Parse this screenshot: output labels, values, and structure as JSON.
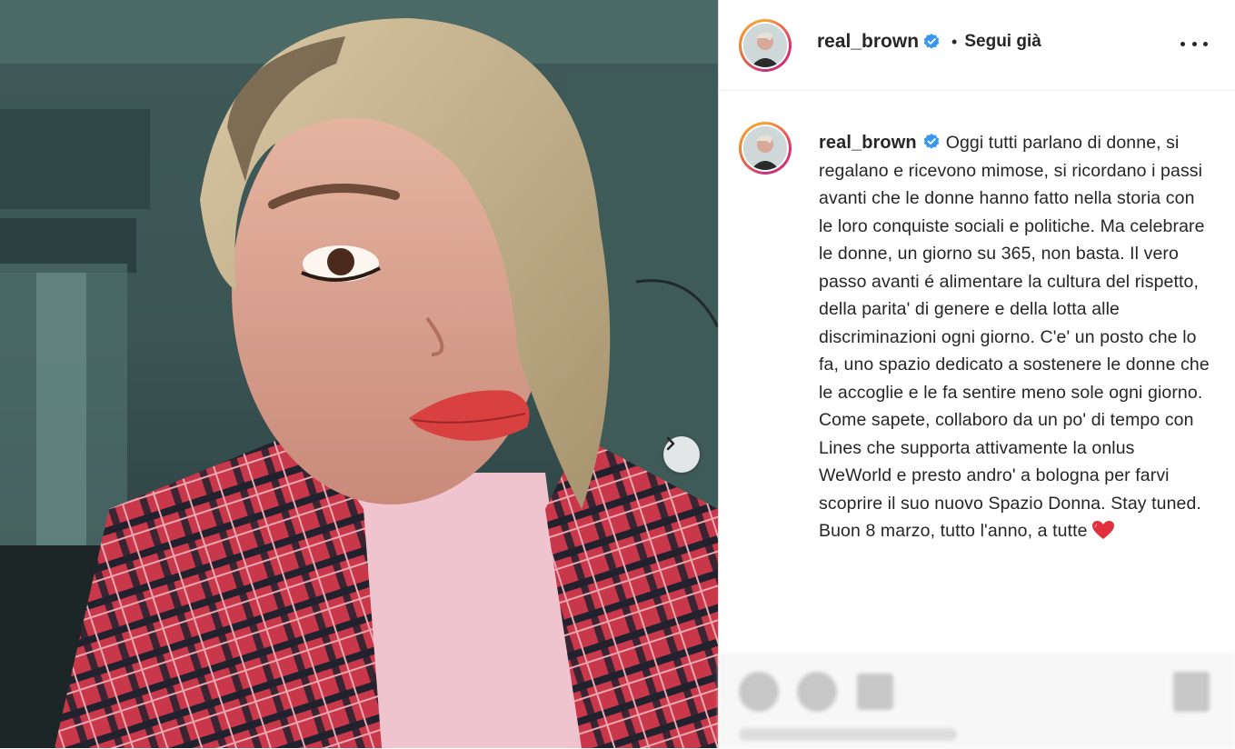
{
  "post": {
    "username": "real_brown",
    "follow_status": "Segui già",
    "caption": "Oggi tutti parlano di donne, si regalano e ricevono mimose, si ricordano i passi avanti che le donne hanno fatto nella storia con le loro conquiste sociali e politiche. Ma celebrare le donne, un giorno su 365, non basta. Il vero passo avanti é alimentare la cultura del rispetto, della parita' di genere e della lotta alle discriminazioni ogni giorno. C'e' un posto che lo fa, uno spazio dedicato a sostenere le donne che le accoglie e le fa sentire meno sole ogni giorno. Come sapete, collaboro da un po' di tempo con Lines che supporta attivamente la onlus WeWorld e presto andro' a bologna per farvi scoprire il suo nuovo Spazio Donna. Stay tuned. Buon 8 marzo, tutto l'anno, a tutte"
  },
  "colors": {
    "verified_blue": "#3897f0",
    "heart_red": "#e0303b",
    "avatar_ring": "#e1306c"
  },
  "icons": {
    "more": "more-options-icon",
    "verified": "verified-badge-icon",
    "heart": "red-heart-icon",
    "next": "chevron-right-icon"
  }
}
